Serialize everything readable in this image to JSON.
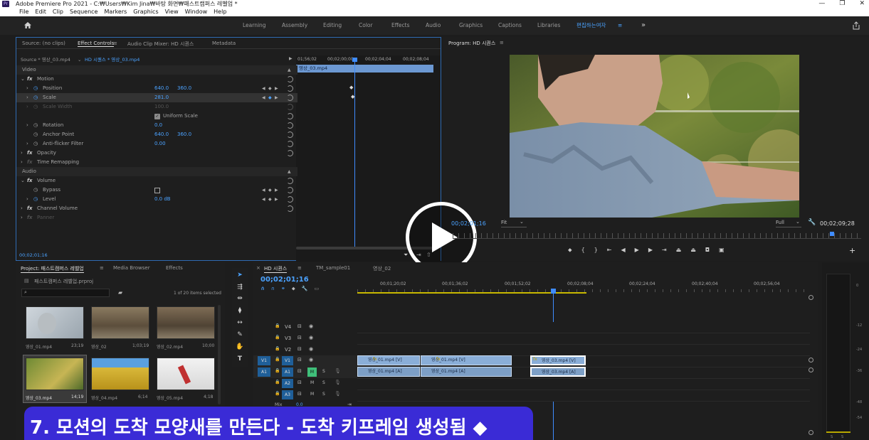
{
  "window": {
    "title": "Adobe Premiere Pro 2021 - C:₩Users₩Kim Jina₩바탕 화면₩패스트캠퍼스 레벨업 *",
    "app_icon": "Pr",
    "controls": [
      "—",
      "❐",
      "✕"
    ]
  },
  "menu": [
    "File",
    "Edit",
    "Clip",
    "Sequence",
    "Markers",
    "Graphics",
    "View",
    "Window",
    "Help"
  ],
  "workspaces": [
    "Learning",
    "Assembly",
    "Editing",
    "Color",
    "Effects",
    "Audio",
    "Graphics",
    "Captions",
    "Libraries",
    "편집하는여자"
  ],
  "workspace_menu": "≡",
  "workspace_more": "»",
  "effect_controls": {
    "tabs": [
      "Source: (no clips)",
      "Effect Controls",
      "Audio Clip Mixer: HD 시퀀스",
      "Metadata"
    ],
    "tab_menu": "≡",
    "source": "Source * 영상_03.mp4",
    "sequence": "HD 시퀀스 * 영상_03.mp4",
    "ruler": [
      "01;56;02",
      "00;02;00;00",
      "00;02;04;04",
      "00;02;08;04"
    ],
    "clip_label": "영상_03.mp4",
    "sections": {
      "video": "Video",
      "audio": "Audio"
    },
    "motion": "Motion",
    "position": {
      "label": "Position",
      "x": "640.0",
      "y": "360.0"
    },
    "scale": {
      "label": "Scale",
      "value": "281.0"
    },
    "scale_width": {
      "label": "Scale Width",
      "value": "100.0"
    },
    "uniform_scale": "Uniform Scale",
    "rotation": {
      "label": "Rotation",
      "value": "0.0"
    },
    "anchor": {
      "label": "Anchor Point",
      "x": "640.0",
      "y": "360.0"
    },
    "antiflicker": {
      "label": "Anti-flicker Filter",
      "value": "0.00"
    },
    "opacity": "Opacity",
    "time_remap": "Time Remapping",
    "volume": "Volume",
    "bypass": "Bypass",
    "level": {
      "label": "Level",
      "value": "0.0 dB"
    },
    "channel_volume": "Channel Volume",
    "panner": "Panner",
    "timecode": "00;02;01;16"
  },
  "program": {
    "title": "Program: HD 시퀀스",
    "menu": "≡",
    "timecode_left": "00;02;01;16",
    "fit": "Fit",
    "quality": "Full",
    "timecode_right": "00;02;09;28"
  },
  "project": {
    "tabs": [
      "Project: 패스트캠퍼스 레벨업",
      "Media Browser",
      "Effects"
    ],
    "tab_menu": "≡",
    "file": "패스트캠퍼스 레벨업.prproj",
    "items_selected": "1 of 20 items selected",
    "items": [
      {
        "name": "영상_01.mp4",
        "dur": "23;19"
      },
      {
        "name": "영상_02",
        "dur": "1;03;19"
      },
      {
        "name": "영상_02.mp4",
        "dur": "10;00"
      },
      {
        "name": "영상_03.mp4",
        "dur": "14;19"
      },
      {
        "name": "영상_04.mp4",
        "dur": "6;14"
      },
      {
        "name": "영상_05.mp4",
        "dur": "4;18"
      }
    ]
  },
  "timeline": {
    "close": "×",
    "tabs": [
      "HD 시퀀스",
      "TM_sample01",
      "영상_02"
    ],
    "tab_menu": "≡",
    "timecode": "00;02;01;16",
    "ruler": [
      "00;01;20;02",
      "00;01;36;02",
      "00;01;52;02",
      "00;02;08;04",
      "00;02;24;04",
      "00;02;40;04",
      "00;02;56;04"
    ],
    "video_tracks": [
      "V4",
      "V3",
      "V2",
      "V1"
    ],
    "audio_tracks": [
      "A1",
      "A2",
      "A3"
    ],
    "src_v": "V1",
    "src_a": "A1",
    "mute": "M",
    "solo": "S",
    "mix": {
      "label": "Mix",
      "value": "0.0"
    },
    "clips": {
      "v1": [
        "영상_01.mp4 [V]",
        "영상_01.mp4 [V]",
        "영상_03.mp4 [V]"
      ],
      "a1": [
        "영상_01.mp4 [A]",
        "영상_01.mp4 [A]",
        "영상_03.mp4 [A]"
      ]
    }
  },
  "meter": {
    "ticks": [
      "0",
      "-12",
      "-24",
      "-36",
      "-48",
      "-54"
    ],
    "solo": [
      "S",
      "S"
    ]
  },
  "caption": "7. 모션의 도착 모양새를 만든다 - 도착 키프레임 생성됨 ◆"
}
